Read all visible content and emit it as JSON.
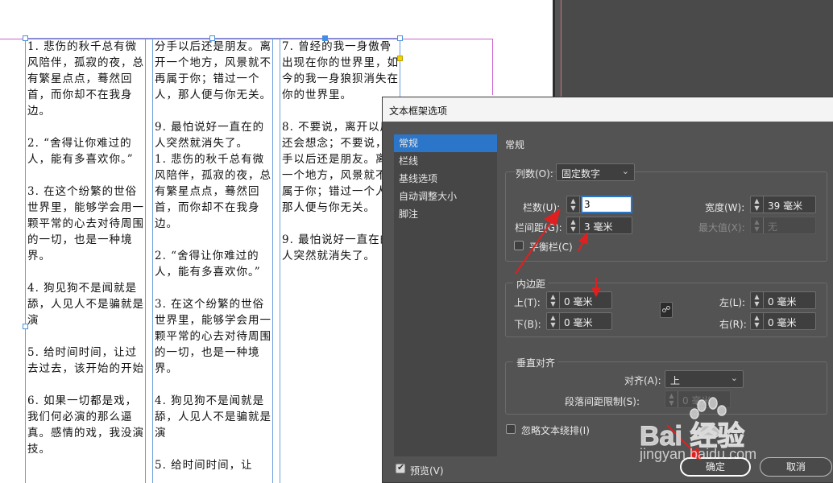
{
  "document": {
    "column_1_text": "1. 悲伤的秋千总有微风陪伴，孤寂的夜，总有繁星点点，蓦然回首，而你却不在我身边。\n\n2. “舍得让你难过的人，能有多喜欢你。”\n\n3. 在这个纷繁的世俗世界里，能够学会用一颗平常的心去对待周围的一切，也是一种境界。\n\n4. 狗见狗不是闻就是舔，人见人不是骗就是演\n\n5. 给时间时间，让过去过去，该开始的开始\n\n6. 如果一切都是戏，我们何必演的那么逼真。感情的戏，我没演技。",
    "column_2_text": "分手以后还是朋友。离开一个地方，风景就不再属于你；错过一个人，那人便与你无关。\n\n9. 最怕说好一直在的人突然就消失了。\n1. 悲伤的秋千总有微风陪伴，孤寂的夜，总有繁星点点，蓦然回首，而你却不在我身边。\n\n2. “舍得让你难过的人，能有多喜欢你。”\n\n3. 在这个纷繁的世俗世界里，能够学会用一颗平常的心去对待周围的一切，也是一种境界。\n\n4. 狗见狗不是闻就是舔，人见人不是骗就是演\n\n5. 给时间时间，让",
    "column_3_text": "7. 曾经的我一身傲骨出现在你的世界里，如今的我一身狼狈消失在你的世界里。\n\n8. 不要说，离开以后还会想念；不要说，分手以后还是朋友。离开一个地方，风景就不再属于你；错过一个人，那人便与你无关。\n\n9. 最怕说好一直在的人突然就消失了。"
  },
  "dialog": {
    "title": "文本框架选项",
    "nav_items": [
      "常规",
      "栏线",
      "基线选项",
      "自动调整大小",
      "脚注"
    ],
    "section_title": "常规",
    "columns": {
      "label": "列数(O):",
      "value": "固定数字",
      "number_label": "栏数(U):",
      "number_value": "3",
      "width_label": "宽度(W):",
      "width_value": "39 毫米",
      "gutter_label": "栏间距(G):",
      "gutter_value": "3 毫米",
      "max_label": "最大值(X):",
      "max_value": "无",
      "balance_label": "平衡栏(C)"
    },
    "inset": {
      "legend": "内边距",
      "top_label": "上(T):",
      "top_value": "0 毫米",
      "bottom_label": "下(B):",
      "bottom_value": "0 毫米",
      "left_label": "左(L):",
      "left_value": "0 毫米",
      "right_label": "右(R):",
      "right_value": "0 毫米"
    },
    "vertical": {
      "legend": "垂直对齐",
      "align_label": "对齐(A):",
      "align_value": "上",
      "spacing_label": "段落间距限制(S):",
      "spacing_value": "0 毫米"
    },
    "ignore_wrap_label": "忽略文本绕排(I)",
    "preview_label": "预览(V)",
    "ok_label": "确定",
    "cancel_label": "取消"
  },
  "watermark": {
    "brand": "Bai 经验",
    "url": "jingyan.baidu.com"
  },
  "colors": {
    "dialog_bg": "#535353",
    "accent": "#2b76c9",
    "arrow": "#e02020"
  }
}
